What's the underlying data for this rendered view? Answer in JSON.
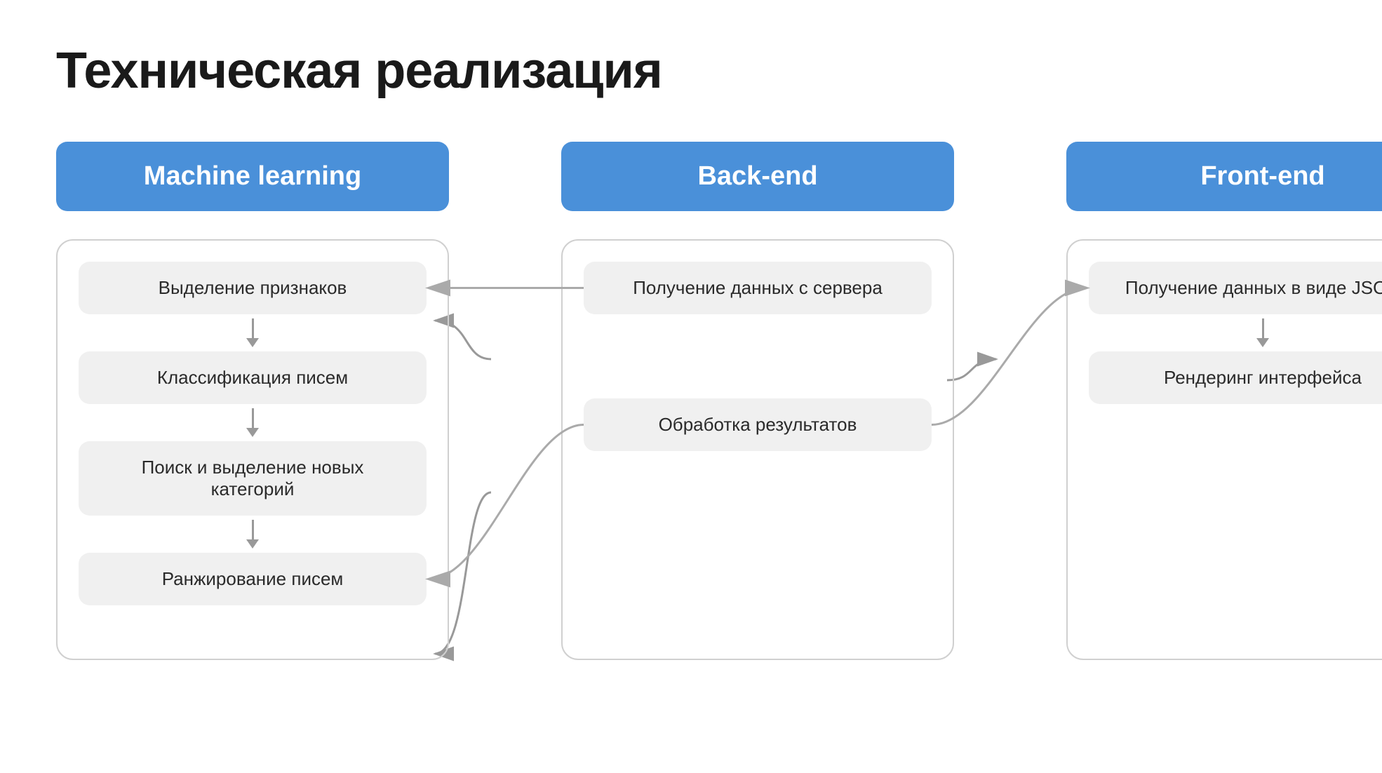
{
  "page": {
    "title": "Техническая реализация",
    "accent_color": "#4a90d9"
  },
  "columns": [
    {
      "id": "ml",
      "header": "Machine learning",
      "steps": [
        "Выделение признаков",
        "Классификация писем",
        "Поиск и выделение новых категорий",
        "Ранжирование писем"
      ]
    },
    {
      "id": "backend",
      "header": "Back-end",
      "steps": [
        "Получение данных с сервера",
        "Обработка результатов"
      ]
    },
    {
      "id": "frontend",
      "header": "Front-end",
      "steps": [
        "Получение данных в виде JSON",
        "Рендеринг интерфейса"
      ]
    }
  ]
}
